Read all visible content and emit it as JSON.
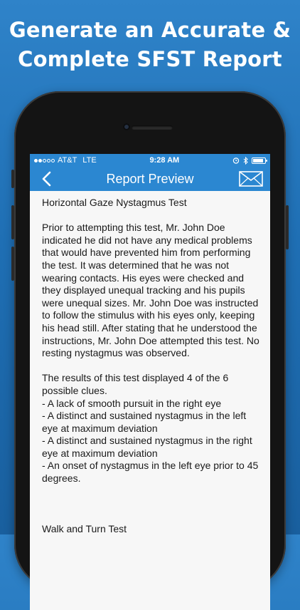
{
  "headline": {
    "line1": "Generate an Accurate &",
    "line2": "Complete SFST Report"
  },
  "status_bar": {
    "carrier": "AT&T",
    "network": "LTE",
    "time": "9:28 AM",
    "signal_bars_filled": 2,
    "signal_bars_total": 5,
    "battery_level": 0.85
  },
  "nav": {
    "title": "Report Preview",
    "back_icon": "chevron-left-icon",
    "mail_icon": "envelope-icon"
  },
  "report": {
    "section1_title": "Horizontal Gaze Nystagmus Test",
    "section1_paragraph": "Prior to attempting this test, Mr. John Doe indicated he did not have any medical problems that would have prevented him from performing the test. It was determined that he was not wearing contacts. His eyes were checked and they displayed unequal tracking and his pupils were unequal sizes. Mr. John Doe was instructed to follow the stimulus with his eyes only, keeping his head still. After stating that he understood the instructions, Mr. John Doe attempted this test. No resting nystagmus was observed.",
    "results_intro": "The results of this test displayed 4 of the 6 possible clues.",
    "clues": [
      "- A lack of smooth pursuit in the right eye",
      "- A distinct and sustained nystagmus in the left eye at maximum deviation",
      "- A distinct and sustained nystagmus in the right eye at maximum deviation",
      "- An onset of nystagmus in the left eye prior to 45 degrees."
    ],
    "section2_title": "Walk and Turn Test"
  },
  "colors": {
    "background_top": "#2f83c9",
    "background_bottom": "#195f9e",
    "nav_bar": "#2b87d1",
    "phone_body": "#141414",
    "screen_bg": "#f7f7f7"
  }
}
